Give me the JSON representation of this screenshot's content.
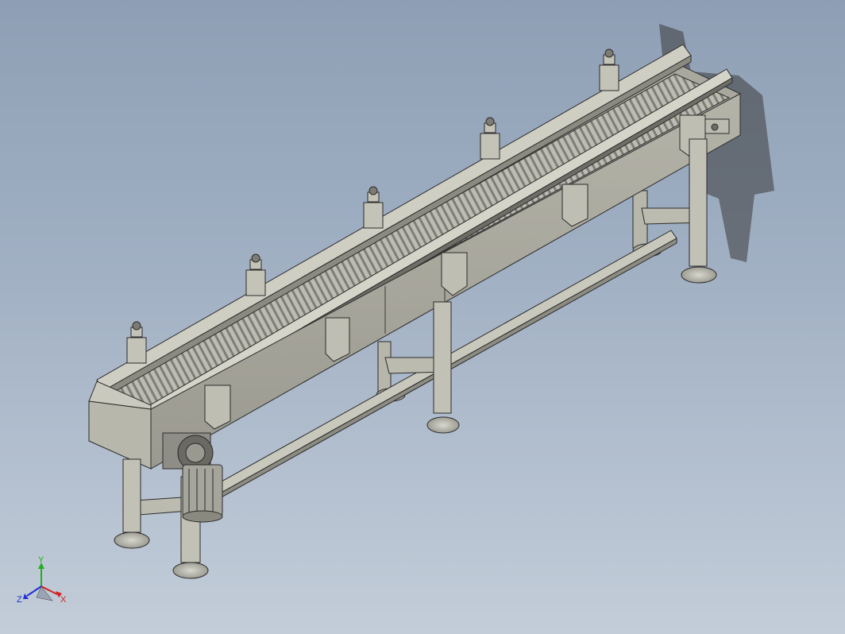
{
  "triad": {
    "x_label": "X",
    "y_label": "Y",
    "z_label": "Z",
    "x_color": "#d42020",
    "y_color": "#20b020",
    "z_color": "#2030d0"
  },
  "colors": {
    "background_top": "#8e9fb5",
    "background_bottom": "#c3cdd9",
    "frame_light": "#c7c6bb",
    "frame_mid": "#a8a79c",
    "frame_dark": "#6f6e66",
    "outline": "#2b2b2b"
  }
}
